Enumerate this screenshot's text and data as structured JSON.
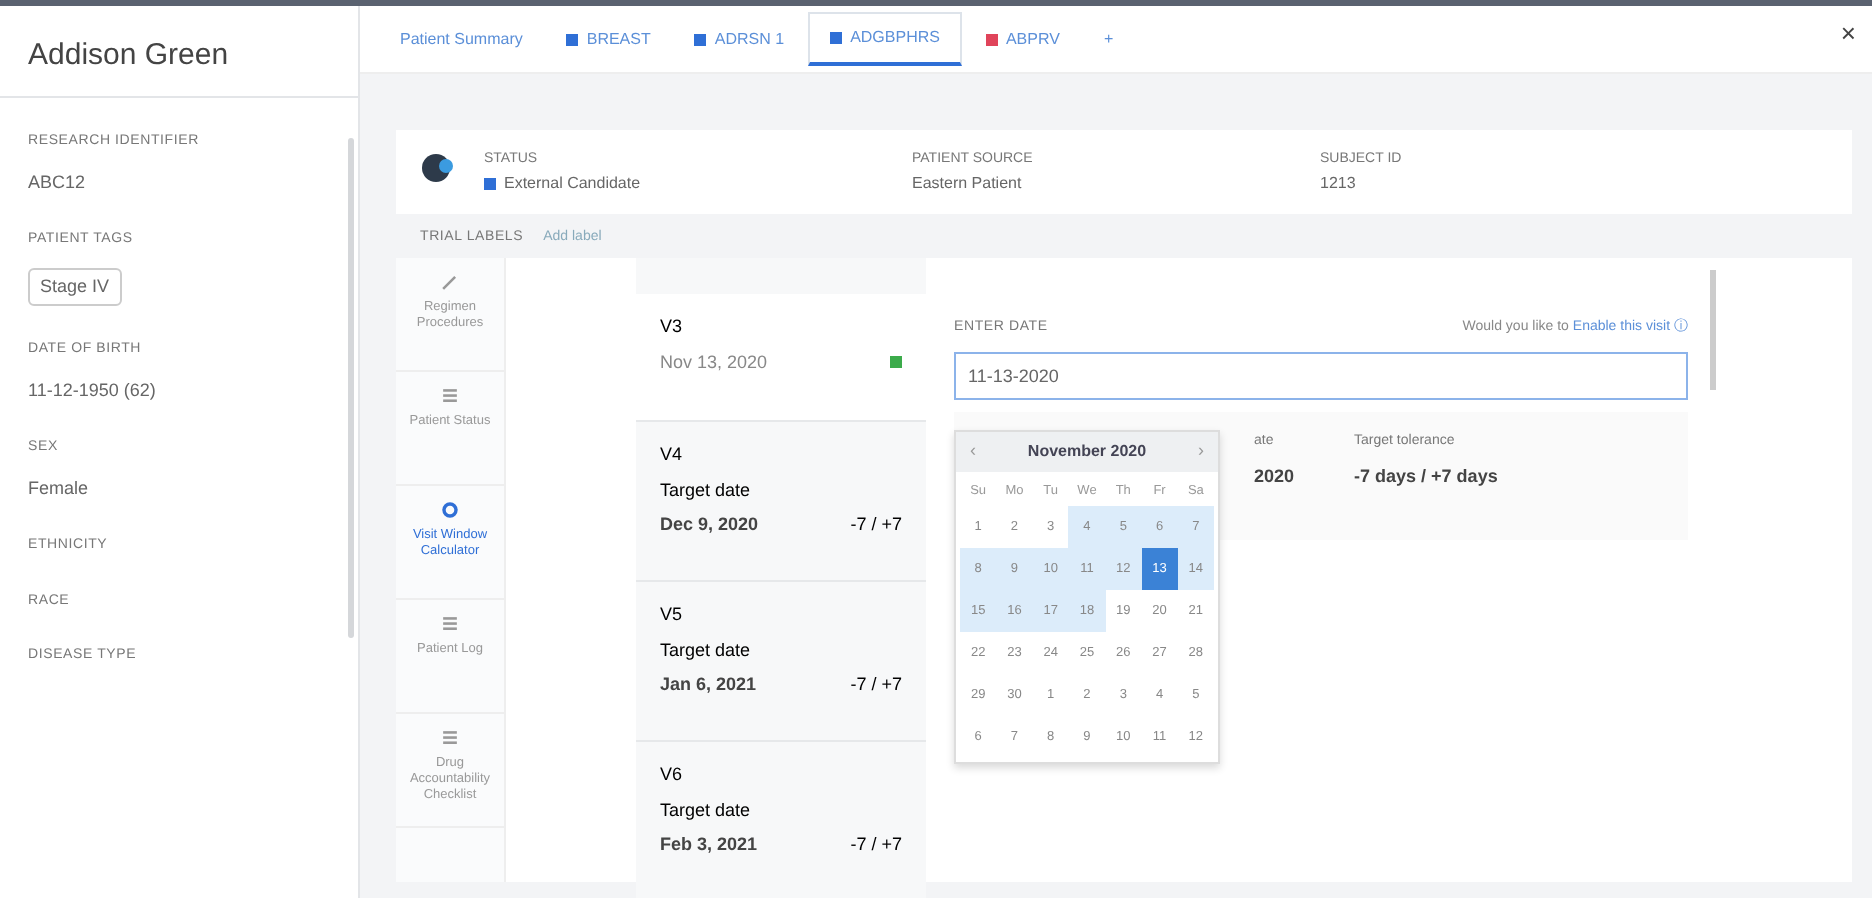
{
  "patient": {
    "name": "Addison Green"
  },
  "close": "×",
  "fields": [
    {
      "label": "RESEARCH IDENTIFIER",
      "value": "ABC12",
      "kind": "text"
    },
    {
      "label": "PATIENT TAGS",
      "value": "Stage IV",
      "kind": "tag"
    },
    {
      "label": "DATE OF BIRTH",
      "value": "11-12-1950 (62)",
      "kind": "text"
    },
    {
      "label": "SEX",
      "value": "Female",
      "kind": "text"
    },
    {
      "label": "ETHNICITY"
    },
    {
      "label": "RACE"
    },
    {
      "label": "DISEASE TYPE"
    }
  ],
  "tabs": [
    {
      "label": "Patient Summary",
      "selected": false
    },
    {
      "label": "BREAST",
      "color": "#2f6fd6",
      "selected": false
    },
    {
      "label": "ADRSN 1",
      "color": "#2f6fd6",
      "selected": false
    },
    {
      "label": "ADGBPHRS",
      "color": "#2f6fd6",
      "selected": true
    },
    {
      "label": "ABPRV",
      "color": "#e0445a",
      "selected": false
    }
  ],
  "add_tab": "+",
  "header": {
    "status_label": "STATUS",
    "status": "External Candidate",
    "source_label": "PATIENT SOURCE",
    "source": "Eastern Patient",
    "subject_label": "SUBJECT ID",
    "subject": "1213"
  },
  "trial_labels": {
    "label": "TRIAL LABELS",
    "action": "Add label"
  },
  "nav": [
    {
      "label": "Regimen Procedures",
      "kind": "pen",
      "selected": false
    },
    {
      "label": "Patient Status",
      "kind": "list",
      "selected": false
    },
    {
      "label": "Visit Window Calculator",
      "kind": "gear",
      "selected": true
    },
    {
      "label": "Patient Log",
      "kind": "list",
      "selected": false
    },
    {
      "label": "Drug Accountability Checklist",
      "kind": "list",
      "selected": false
    }
  ],
  "visits": [
    {
      "name": "V3",
      "date": "Nov 13, 2020",
      "done": true,
      "selected": true
    },
    {
      "name": "V4",
      "target_label": "Target date",
      "date": "Dec 9, 2020",
      "tolerance": "-7 / +7",
      "done": false,
      "selected": false
    },
    {
      "name": "V5",
      "target_label": "Target date",
      "date": "Jan 6, 2021",
      "tolerance": "-7 / +7",
      "done": false,
      "selected": false
    },
    {
      "name": "V6",
      "target_label": "Target date",
      "date": "Feb 3, 2021",
      "tolerance": "-7 / +7",
      "done": false,
      "selected": false
    }
  ],
  "detail": {
    "enter_label": "ENTER DATE",
    "hint": "Would you like to",
    "hint_link": "Enable this visit",
    "info": "ⓘ",
    "date_value": "11-13-2020",
    "info_cols": [
      {
        "label": "ate",
        "value": "2020"
      },
      {
        "label": "Target tolerance",
        "value": "-7 days / +7 days"
      }
    ]
  },
  "calendar": {
    "prev": "‹",
    "title": "November 2020",
    "next": "›",
    "weekdays": [
      "Su",
      "Mo",
      "Tu",
      "We",
      "Th",
      "Fr",
      "Sa"
    ],
    "days": [
      {
        "day": "1",
        "in_range": false,
        "selected": false
      },
      {
        "day": "2",
        "in_range": false,
        "selected": false
      },
      {
        "day": "3",
        "in_range": false,
        "selected": false
      },
      {
        "day": "4",
        "in_range": true,
        "selected": false
      },
      {
        "day": "5",
        "in_range": true,
        "selected": false
      },
      {
        "day": "6",
        "in_range": true,
        "selected": false
      },
      {
        "day": "7",
        "in_range": true,
        "selected": false
      },
      {
        "day": "8",
        "in_range": true,
        "selected": false
      },
      {
        "day": "9",
        "in_range": true,
        "selected": false
      },
      {
        "day": "10",
        "in_range": true,
        "selected": false
      },
      {
        "day": "11",
        "in_range": true,
        "selected": false
      },
      {
        "day": "12",
        "in_range": true,
        "selected": false
      },
      {
        "day": "13",
        "selected": true
      },
      {
        "day": "14",
        "in_range": true,
        "selected": false
      },
      {
        "day": "15",
        "in_range": true,
        "selected": false
      },
      {
        "day": "16",
        "in_range": true,
        "selected": false
      },
      {
        "day": "17",
        "in_range": true,
        "selected": false
      },
      {
        "day": "18",
        "in_range": true,
        "selected": false
      },
      {
        "day": "19",
        "in_range": false,
        "selected": false
      },
      {
        "day": "20",
        "in_range": false,
        "selected": false
      },
      {
        "day": "21",
        "in_range": false,
        "selected": false
      },
      {
        "day": "22",
        "in_range": false,
        "selected": false
      },
      {
        "day": "23",
        "in_range": false,
        "selected": false
      },
      {
        "day": "24",
        "in_range": false,
        "selected": false
      },
      {
        "day": "25",
        "in_range": false,
        "selected": false
      },
      {
        "day": "26",
        "in_range": false,
        "selected": false
      },
      {
        "day": "27",
        "in_range": false,
        "selected": false
      },
      {
        "day": "28",
        "in_range": false,
        "selected": false
      },
      {
        "day": "29",
        "in_range": false,
        "selected": false
      },
      {
        "day": "30",
        "in_range": false,
        "selected": false
      },
      {
        "day": "1",
        "in_range": false,
        "selected": false
      },
      {
        "day": "2",
        "in_range": false,
        "selected": false
      },
      {
        "day": "3",
        "in_range": false,
        "selected": false
      },
      {
        "day": "4",
        "in_range": false,
        "selected": false
      },
      {
        "day": "5",
        "in_range": false,
        "selected": false
      },
      {
        "day": "6",
        "in_range": false,
        "selected": false
      },
      {
        "day": "7",
        "in_range": false,
        "selected": false
      },
      {
        "day": "8",
        "in_range": false,
        "selected": false
      },
      {
        "day": "9",
        "in_range": false,
        "selected": false
      },
      {
        "day": "10",
        "in_range": false,
        "selected": false
      },
      {
        "day": "11",
        "in_range": false,
        "selected": false
      },
      {
        "day": "12",
        "in_range": false,
        "selected": false
      }
    ]
  }
}
